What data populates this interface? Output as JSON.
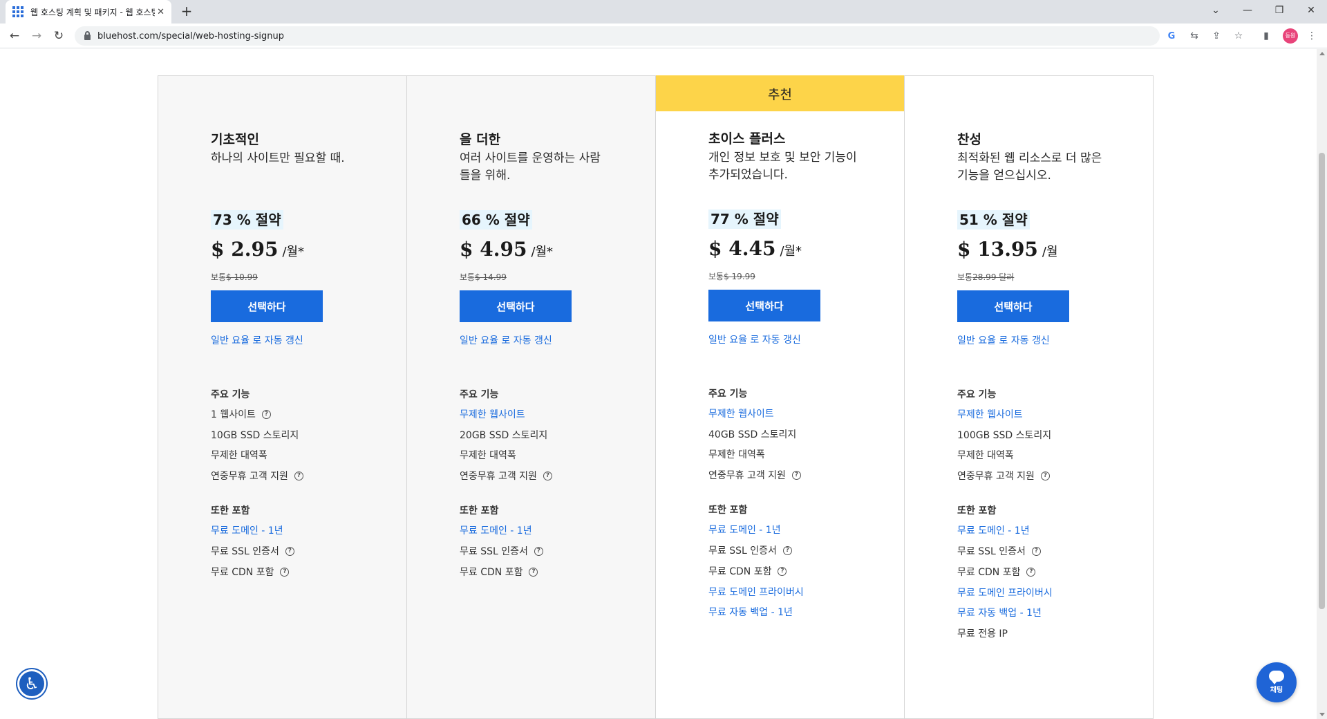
{
  "browser": {
    "tab_title": "웹 호스팅 계획 및 패키지 - 웹 호스팅",
    "url": "bluehost.com/special/web-hosting-signup",
    "profile_initial": "동원"
  },
  "recommended_label": "추천",
  "plans": [
    {
      "name": "기초적인",
      "description": "하나의 사이트만 필요할 때.",
      "savings": "73 % 절약",
      "price": "$ 2.95",
      "per": "/월*",
      "regular_label": "보통",
      "regular_price": "$ 10.99",
      "button": "선택하다",
      "renew": "일반 요율 로 자동 갱신",
      "features_title": "주요 기능",
      "features": [
        "1 웹사이트",
        "10GB SSD 스토리지",
        "무제한 대역폭",
        "연중무휴 고객 지원"
      ],
      "includes_title": "또한 포함",
      "includes": [
        "무료 도메인 - 1년",
        "무료 SSL 인증서",
        "무료 CDN 포함"
      ]
    },
    {
      "name": "을 더한",
      "description": "여러 사이트를 운영하는 사람들을 위해.",
      "savings": "66 % 절약",
      "price": "$ 4.95",
      "per": "/월*",
      "regular_label": "보통",
      "regular_price": "$ 14.99",
      "button": "선택하다",
      "renew": "일반 요율 로 자동 갱신",
      "features_title": "주요 기능",
      "features": [
        "무제한 웹사이트",
        "20GB SSD 스토리지",
        "무제한 대역폭",
        "연중무휴 고객 지원"
      ],
      "includes_title": "또한 포함",
      "includes": [
        "무료 도메인 - 1년",
        "무료 SSL 인증서",
        "무료 CDN 포함"
      ]
    },
    {
      "name": "초이스 플러스",
      "description": "개인 정보 보호 및 보안 기능이 추가되었습니다.",
      "savings": "77 % 절약",
      "price": "$ 4.45",
      "per": "/월*",
      "regular_label": "보통",
      "regular_price": "$ 19.99",
      "button": "선택하다",
      "renew": "일반 요율 로 자동 갱신",
      "features_title": "주요 기능",
      "features": [
        "무제한 웹사이트",
        "40GB SSD 스토리지",
        "무제한 대역폭",
        "연중무휴 고객 지원"
      ],
      "includes_title": "또한 포함",
      "includes": [
        "무료 도메인 - 1년",
        "무료 SSL 인증서",
        "무료 CDN 포함",
        "무료 도메인 프라이버시",
        "무료 자동 백업 - 1년"
      ]
    },
    {
      "name": "찬성",
      "description": "최적화된 웹 리소스로 더 많은 기능을 얻으십시오.",
      "savings": "51 % 절약",
      "price": "$ 13.95",
      "per": "/월",
      "regular_label": "보통",
      "regular_price": "28.99 달러",
      "button": "선택하다",
      "renew": "일반 요율 로 자동 갱신",
      "features_title": "주요 기능",
      "features": [
        "무제한 웹사이트",
        "100GB SSD 스토리지",
        "무제한 대역폭",
        "연중무휴 고객 지원"
      ],
      "includes_title": "또한 포함",
      "includes": [
        "무료 도메인 - 1년",
        "무료 SSL 인증서",
        "무료 CDN 포함",
        "무료 도메인 프라이버시",
        "무료 자동 백업 - 1년",
        "무료 전용 IP"
      ]
    }
  ],
  "chat_label": "채팅",
  "colors": {
    "accent": "#196bde",
    "recommended": "#fdd449",
    "savings_bg": "#e6f5fd"
  }
}
